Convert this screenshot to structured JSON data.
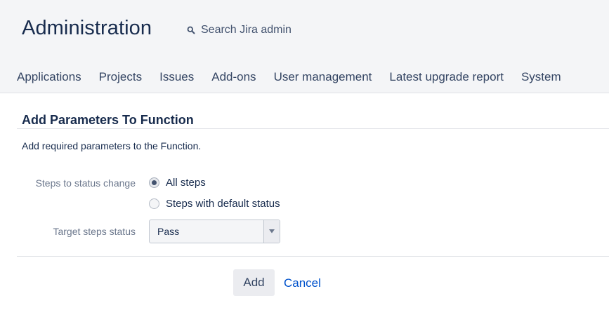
{
  "header": {
    "title": "Administration",
    "search_placeholder": "Search Jira admin"
  },
  "nav": {
    "items": [
      "Applications",
      "Projects",
      "Issues",
      "Add-ons",
      "User management",
      "Latest upgrade report",
      "System"
    ]
  },
  "form": {
    "title": "Add Parameters To Function",
    "description": "Add required parameters to the Function.",
    "steps_label": "Steps to status change",
    "radio_options": [
      {
        "label": "All steps",
        "checked": true
      },
      {
        "label": "Steps with default status",
        "checked": false
      }
    ],
    "target_label": "Target steps status",
    "target_value": "Pass",
    "add_button": "Add",
    "cancel_link": "Cancel"
  },
  "icons": [
    "search-icon",
    "chevron-down-icon"
  ],
  "colors": {
    "header_bg": "#f4f5f7",
    "link": "#0052cc",
    "text": "#172b4d"
  }
}
